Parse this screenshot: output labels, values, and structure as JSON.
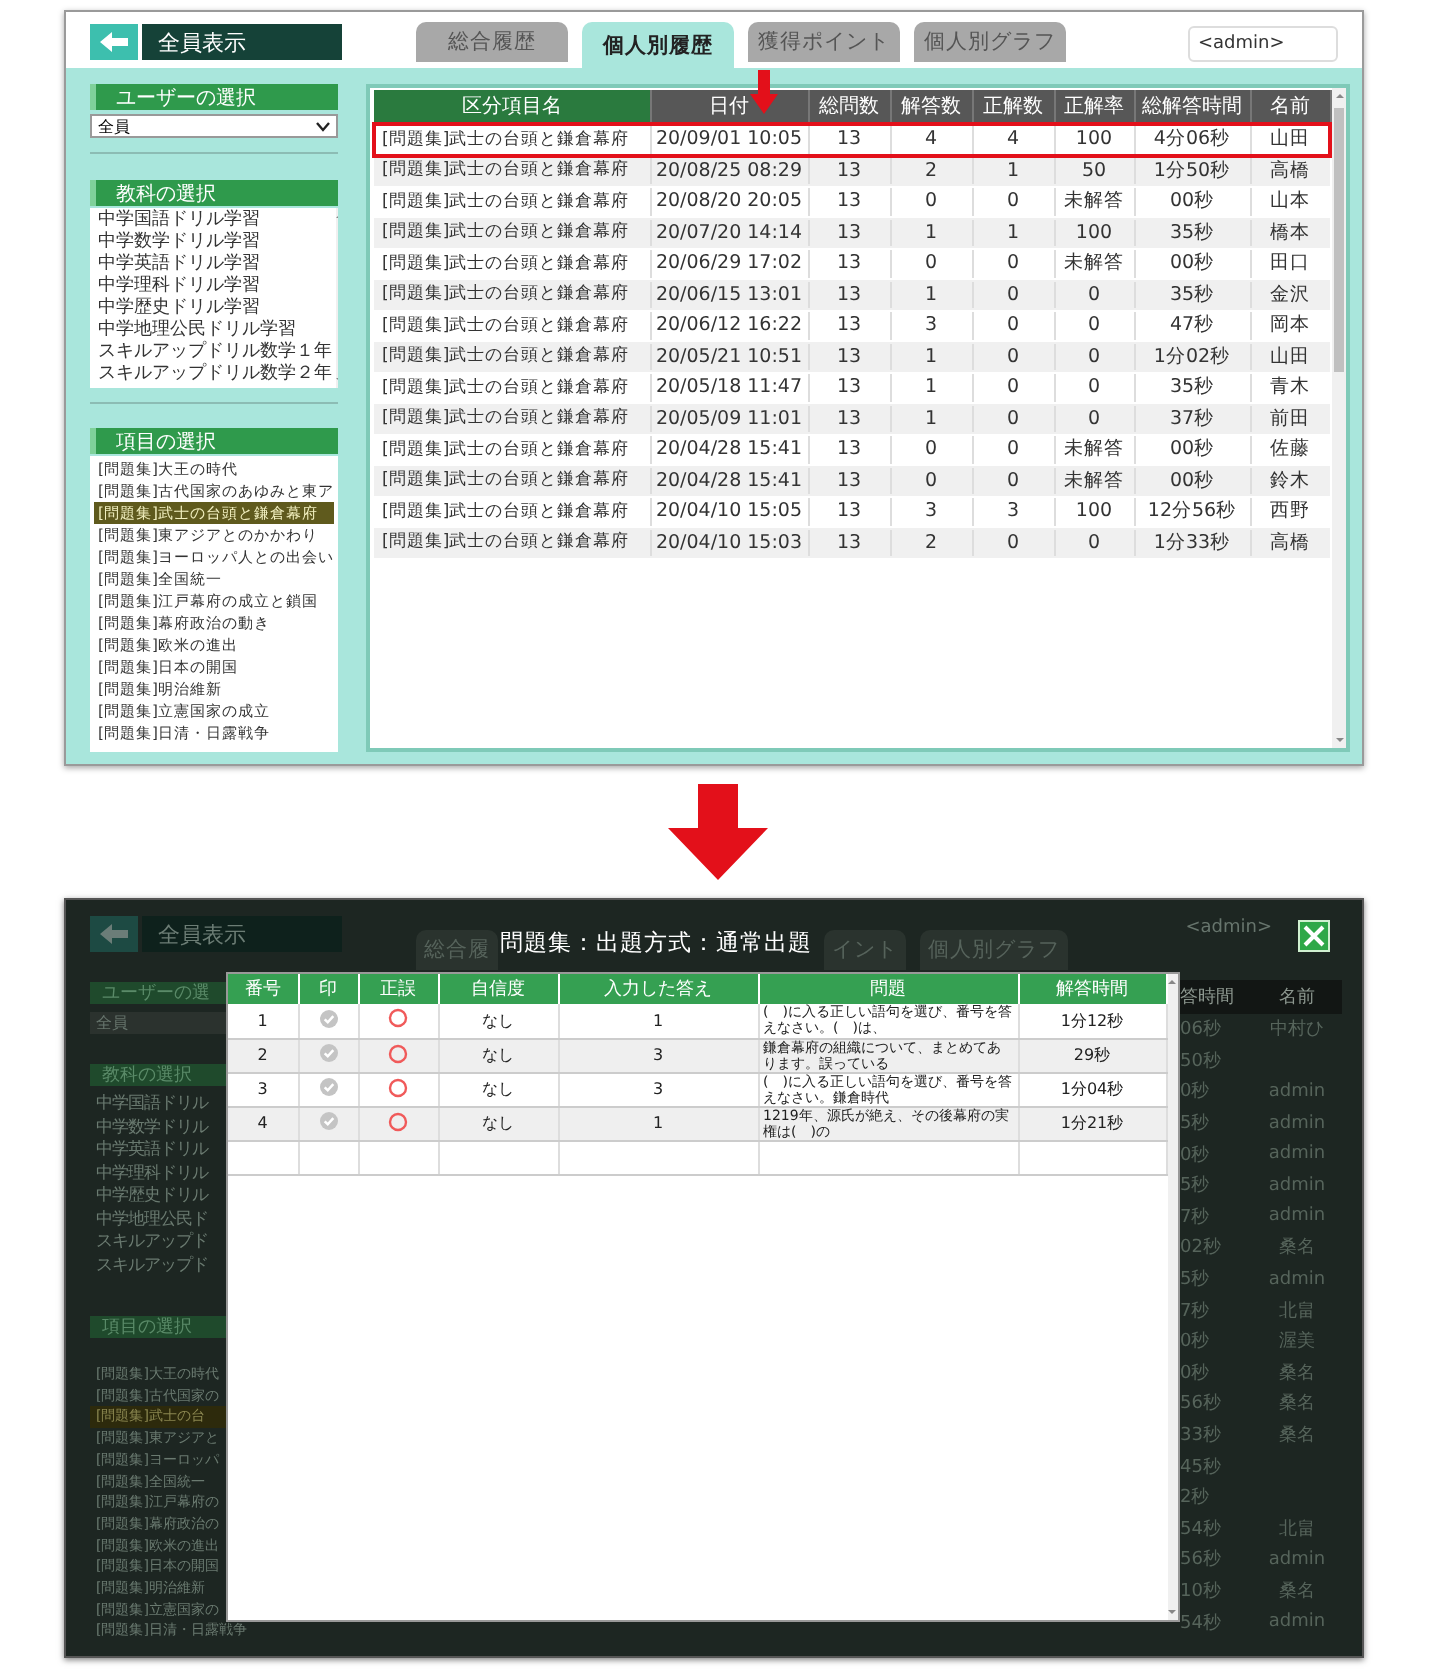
{
  "top": {
    "back_label": "全員表示",
    "tabs": [
      {
        "label": "総合履歴",
        "selected": false
      },
      {
        "label": "個人別履歴",
        "selected": true
      },
      {
        "label": "獲得ポイント",
        "selected": false
      },
      {
        "label": "個人別グラフ",
        "selected": false
      }
    ],
    "user_field": {
      "value": "<admin>"
    },
    "sidebar": {
      "user_header": "ユーザーの選択",
      "user_select": "全員",
      "subject_header": "教科の選択",
      "subjects": [
        {
          "label": "中学国語ドリル学習",
          "selected": false
        },
        {
          "label": "中学数学ドリル学習",
          "selected": false
        },
        {
          "label": "中学英語ドリル学習",
          "selected": false
        },
        {
          "label": "中学理科ドリル学習",
          "selected": false
        },
        {
          "label": "中学歴史ドリル学習",
          "selected": false
        },
        {
          "label": "中学地理公民ドリル学習",
          "selected": false
        },
        {
          "label": "スキルアップドリル数学１年",
          "selected": false
        },
        {
          "label": "スキルアップドリル数学２年",
          "selected": false
        }
      ],
      "item_header": "項目の選択",
      "items": [
        {
          "label": "[問題集]大王の時代",
          "selected": false
        },
        {
          "label": "[問題集]古代国家のあゆみと東ア",
          "selected": false
        },
        {
          "label": "[問題集]武士の台頭と鎌倉幕府",
          "selected": true
        },
        {
          "label": "[問題集]東アジアとのかかわり",
          "selected": false
        },
        {
          "label": "[問題集]ヨーロッパ人との出会い",
          "selected": false
        },
        {
          "label": "[問題集]全国統一",
          "selected": false
        },
        {
          "label": "[問題集]江戸幕府の成立と鎖国",
          "selected": false
        },
        {
          "label": "[問題集]幕府政治の動き",
          "selected": false
        },
        {
          "label": "[問題集]欧米の進出",
          "selected": false
        },
        {
          "label": "[問題集]日本の開国",
          "selected": false
        },
        {
          "label": "[問題集]明治維新",
          "selected": false
        },
        {
          "label": "[問題集]立憲国家の成立",
          "selected": false
        },
        {
          "label": "[問題集]日清・日露戦争",
          "selected": false
        }
      ]
    },
    "table": {
      "columns": [
        "区分項目名",
        "日付",
        "総問数",
        "解答数",
        "正解数",
        "正解率",
        "総解答時間",
        "名前"
      ],
      "rows": [
        {
          "highlighted": true,
          "cells": [
            "[問題集]武士の台頭と鎌倉幕府",
            "20/09/01 10:05",
            "13",
            "4",
            "4",
            "100",
            "4分06秒",
            "山田"
          ]
        },
        {
          "highlighted": false,
          "cells": [
            "[問題集]武士の台頭と鎌倉幕府",
            "20/08/25 08:29",
            "13",
            "2",
            "1",
            "50",
            "1分50秒",
            "高橋"
          ]
        },
        {
          "highlighted": false,
          "cells": [
            "[問題集]武士の台頭と鎌倉幕府",
            "20/08/20 20:05",
            "13",
            "0",
            "0",
            "未解答",
            "00秒",
            "山本"
          ]
        },
        {
          "highlighted": false,
          "cells": [
            "[問題集]武士の台頭と鎌倉幕府",
            "20/07/20 14:14",
            "13",
            "1",
            "1",
            "100",
            "35秒",
            "橋本"
          ]
        },
        {
          "highlighted": false,
          "cells": [
            "[問題集]武士の台頭と鎌倉幕府",
            "20/06/29 17:02",
            "13",
            "0",
            "0",
            "未解答",
            "00秒",
            "田口"
          ]
        },
        {
          "highlighted": false,
          "cells": [
            "[問題集]武士の台頭と鎌倉幕府",
            "20/06/15 13:01",
            "13",
            "1",
            "0",
            "0",
            "35秒",
            "金沢"
          ]
        },
        {
          "highlighted": false,
          "cells": [
            "[問題集]武士の台頭と鎌倉幕府",
            "20/06/12 16:22",
            "13",
            "3",
            "0",
            "0",
            "47秒",
            "岡本"
          ]
        },
        {
          "highlighted": false,
          "cells": [
            "[問題集]武士の台頭と鎌倉幕府",
            "20/05/21 10:51",
            "13",
            "1",
            "0",
            "0",
            "1分02秒",
            "山田"
          ]
        },
        {
          "highlighted": false,
          "cells": [
            "[問題集]武士の台頭と鎌倉幕府",
            "20/05/18 11:47",
            "13",
            "1",
            "0",
            "0",
            "35秒",
            "青木"
          ]
        },
        {
          "highlighted": false,
          "cells": [
            "[問題集]武士の台頭と鎌倉幕府",
            "20/05/09 11:01",
            "13",
            "1",
            "0",
            "0",
            "37秒",
            "前田"
          ]
        },
        {
          "highlighted": false,
          "cells": [
            "[問題集]武士の台頭と鎌倉幕府",
            "20/04/28 15:41",
            "13",
            "0",
            "0",
            "未解答",
            "00秒",
            "佐藤"
          ]
        },
        {
          "highlighted": false,
          "cells": [
            "[問題集]武士の台頭と鎌倉幕府",
            "20/04/28 15:41",
            "13",
            "0",
            "0",
            "未解答",
            "00秒",
            "鈴木"
          ]
        },
        {
          "highlighted": false,
          "cells": [
            "[問題集]武士の台頭と鎌倉幕府",
            "20/04/10 15:05",
            "13",
            "3",
            "3",
            "100",
            "12分56秒",
            "西野"
          ]
        },
        {
          "highlighted": false,
          "cells": [
            "[問題集]武士の台頭と鎌倉幕府",
            "20/04/10 15:03",
            "13",
            "2",
            "0",
            "0",
            "1分33秒",
            "高橋"
          ]
        }
      ]
    }
  },
  "bottom": {
    "background": {
      "back_label": "全員表示",
      "tabs": [
        "総合履",
        "イント",
        "個人別グラフ"
      ],
      "user_field": "<admin>",
      "user_header": "ユーザーの選",
      "user_select": "全員",
      "subject_header": "教科の選択",
      "subjects": [
        "中学国語ドリル",
        "中学数学ドリル",
        "中学英語ドリル",
        "中学理科ドリル",
        "中学歴史ドリル",
        "中学地理公民ド",
        "スキルアップド",
        "スキルアップド"
      ],
      "item_header": "項目の選択",
      "items": [
        {
          "label": "[問題集]大王の時代",
          "selected": false
        },
        {
          "label": "[問題集]古代国家の",
          "selected": false
        },
        {
          "label": "[問題集]武士の台",
          "selected": true
        },
        {
          "label": "[問題集]東アジアと",
          "selected": false
        },
        {
          "label": "[問題集]ヨーロッパ",
          "selected": false
        },
        {
          "label": "[問題集]全国統一",
          "selected": false
        },
        {
          "label": "[問題集]江戸幕府の",
          "selected": false
        },
        {
          "label": "[問題集]幕府政治の",
          "selected": false
        },
        {
          "label": "[問題集]欧米の進出",
          "selected": false
        },
        {
          "label": "[問題集]日本の開国",
          "selected": false
        },
        {
          "label": "[問題集]明治維新",
          "selected": false
        },
        {
          "label": "[問題集]立憲国家の",
          "selected": false
        },
        {
          "label": "[問題集]日清・日露戦争",
          "selected": false
        }
      ],
      "right_columns": [
        "答時間",
        "名前"
      ],
      "right_rows": [
        [
          "06秒",
          "中村ひ"
        ],
        [
          "50秒",
          ""
        ],
        [
          "0秒",
          "admin"
        ],
        [
          "5秒",
          "admin"
        ],
        [
          "0秒",
          "admin"
        ],
        [
          "5秒",
          "admin"
        ],
        [
          "7秒",
          "admin"
        ],
        [
          "02秒",
          "桑名"
        ],
        [
          "5秒",
          "admin"
        ],
        [
          "7秒",
          "北畠"
        ],
        [
          "0秒",
          "渥美"
        ],
        [
          "0秒",
          "桑名"
        ],
        [
          "56秒",
          "桑名"
        ],
        [
          "33秒",
          "桑名"
        ],
        [
          "45秒",
          ""
        ],
        [
          "2秒",
          ""
        ],
        [
          "54秒",
          "北畠"
        ],
        [
          "56秒",
          "admin"
        ],
        [
          "10秒",
          "桑名"
        ],
        [
          "54秒",
          "admin"
        ]
      ]
    },
    "modal": {
      "title": "問題集：出題方式：通常出題",
      "columns": [
        "番号",
        "印",
        "正誤",
        "自信度",
        "入力した答え",
        "問題",
        "解答時間"
      ],
      "rows": [
        {
          "number": "1",
          "marked": false,
          "correct": true,
          "confidence": "なし",
          "answer": "1",
          "question": "(　)に入る正しい語句を選び、番号を答えなさい。(　)は、",
          "time": "1分12秒"
        },
        {
          "number": "2",
          "marked": false,
          "correct": true,
          "confidence": "なし",
          "answer": "3",
          "question": "鎌倉幕府の組織について、まとめてあります。誤っている",
          "time": "29秒"
        },
        {
          "number": "3",
          "marked": false,
          "correct": true,
          "confidence": "なし",
          "answer": "3",
          "question": "(　)に入る正しい語句を選び、番号を答えなさい。鎌倉時代",
          "time": "1分04秒"
        },
        {
          "number": "4",
          "marked": false,
          "correct": true,
          "confidence": "なし",
          "answer": "1",
          "question": "1219年、源氏が絶え、その後幕府の実権は(　)の",
          "time": "1分21秒"
        }
      ]
    }
  }
}
